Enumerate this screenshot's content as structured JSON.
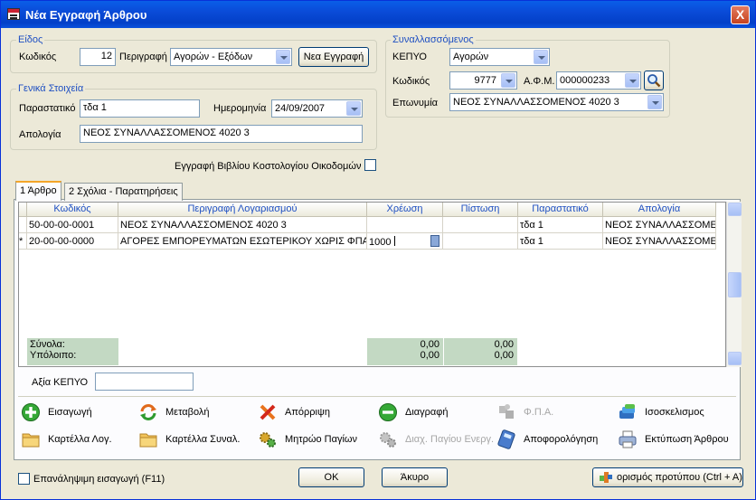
{
  "window": {
    "title": "Νέα Εγγραφή Άρθρου",
    "close_label": "X"
  },
  "eidos": {
    "legend": "Είδος",
    "code_label": "Κωδικός",
    "code_value": "12",
    "desc_label": "Περιγραφή",
    "desc_value": "Αγορών - Εξόδων",
    "new_button": "Νεα Εγγραφή"
  },
  "genika": {
    "legend": "Γενικά Στοιχεία",
    "parastatiko_label": "Παραστατικό",
    "parastatiko_value": "τδα 1",
    "date_label": "Ημερομηνία",
    "date_value": "24/09/2007",
    "apologia_label": "Απολογία",
    "apologia_value": "ΝΕΟΣ ΣΥΝΑΛΛΑΣΣΟΜΕΝΟΣ 4020 3"
  },
  "synallassomenos": {
    "legend": "Συναλλασσόμενος",
    "kepyo_label": "ΚΕΠΥΟ",
    "kepyo_value": "Αγορών",
    "code_label": "Κωδικός",
    "code_value": "9777",
    "afm_label": "Α.Φ.Μ.",
    "afm_value": "000000233",
    "eponymia_label": "Επωνυμία",
    "eponymia_value": "ΝΕΟΣ ΣΥΝΑΛΛΑΣΣΟΜΕΝΟΣ 4020 3"
  },
  "book_label": "Εγγραφή Βιβλίου Κοστολογίου Οικοδομών",
  "tabs": [
    {
      "label": "1 Άρθρο"
    },
    {
      "label": "2 Σχόλια - Παρατηρήσεις"
    }
  ],
  "grid": {
    "headers": [
      "Κωδικός",
      "Περιγραφή Λογαριασμού",
      "Χρέωση",
      "Πίστωση",
      "Παραστατικό",
      "Απολογία"
    ],
    "rows": [
      {
        "marker": "",
        "code": "50-00-00-0001",
        "desc": "ΝΕΟΣ ΣΥΝΑΛΛΑΣΣΟΜΕΝΟΣ 4020 3",
        "debit": "",
        "credit": "",
        "doc": "τδα 1",
        "apologia": "ΝΕΟΣ ΣΥΝΑΛΛΑΣΣΟΜΕΝΟ"
      },
      {
        "marker": "*",
        "code": "20-00-00-0000",
        "desc": "ΑΓΟΡΕΣ ΕΜΠΟΡΕΥΜΑΤΩΝ ΕΣΩΤΕΡΙΚΟΥ ΧΩΡΙΣ ΦΠΑ",
        "debit": "1000",
        "credit": "",
        "doc": "τδα 1",
        "apologia": "ΝΕΟΣ ΣΥΝΑΛΛΑΣΣΟΜΕΝΟ"
      }
    ],
    "totals_label": "Σύνολα:",
    "balance_label": "Υπόλοιπο:",
    "debit_total": "0,00",
    "debit_balance": "0,00",
    "credit_total": "0,00",
    "credit_balance": "0,00"
  },
  "axia_kepyo_label": "Αξία ΚΕΠΥΟ",
  "actions": [
    {
      "label": "Εισαγωγή",
      "icon": "plus-circle-icon"
    },
    {
      "label": "Μεταβολή",
      "icon": "refresh-icon"
    },
    {
      "label": "Απόρριψη",
      "icon": "cross-icon"
    },
    {
      "label": "Διαγραφή",
      "icon": "minus-circle-icon"
    },
    {
      "label": "Φ.Π.Α.",
      "icon": "puzzle-icon"
    },
    {
      "label": "Ισοσκελισμος",
      "icon": "balance-icon"
    },
    {
      "label": "Καρτέλλα Λογ.",
      "icon": "folder-icon"
    },
    {
      "label": "Καρτέλλα Συναλ.",
      "icon": "folder-icon"
    },
    {
      "label": "Μητρώο Παγίων",
      "icon": "gears-icon"
    },
    {
      "label": "Διαχ. Παγίου Ενεργ.",
      "icon": "gears-icon"
    },
    {
      "label": "Αποφορολόγηση",
      "icon": "calculator-icon"
    },
    {
      "label": "Εκτύπωση Άρθρου",
      "icon": "printer-icon"
    }
  ],
  "footer": {
    "repeat_label": "Επανάληψιμη εισαγωγή (F11)",
    "ok_label": "OK",
    "cancel_label": "Άκυρο",
    "template_label": "ορισμός προτύπου (Ctrl + A)"
  },
  "colors": {
    "title_bar": "#0a4bd8",
    "legend_text": "#1e4fc2",
    "totals_bg": "#c3d9c3"
  }
}
